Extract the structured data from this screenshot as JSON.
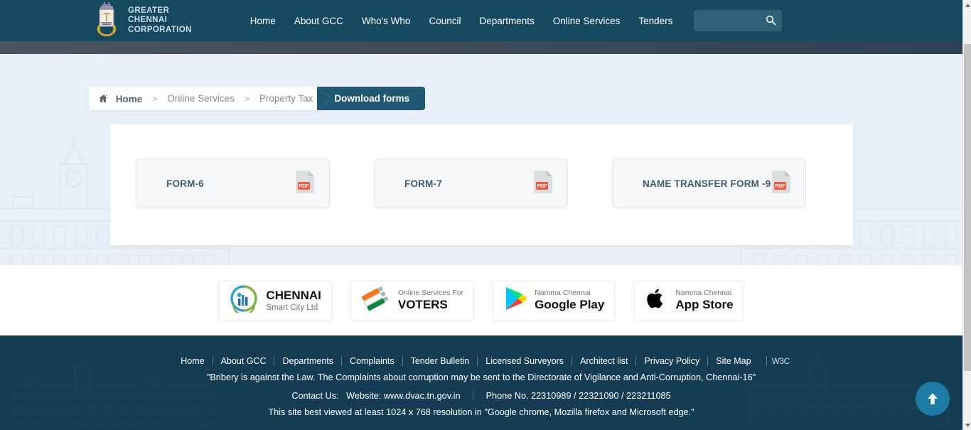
{
  "header": {
    "logo_line1": "GREATER",
    "logo_line2": "CHENNAI",
    "logo_line3": "CORPORATION",
    "nav": [
      {
        "label": "Home"
      },
      {
        "label": "About GCC"
      },
      {
        "label": "Who's Who"
      },
      {
        "label": "Council"
      },
      {
        "label": "Departments"
      },
      {
        "label": "Online Services"
      },
      {
        "label": "Tenders"
      }
    ],
    "search": {
      "value": "",
      "placeholder": ""
    }
  },
  "breadcrumb": {
    "home": "Home",
    "sep1": ">",
    "item2": "Online Services",
    "sep2": ">",
    "item3": "Property Tax",
    "active": "Download forms"
  },
  "main": {
    "cards": [
      {
        "label": "FORM-6",
        "icon": "pdf-icon"
      },
      {
        "label": "FORM-7",
        "icon": "pdf-icon"
      },
      {
        "label": "NAME TRANSFER FORM -9",
        "icon": "pdf-icon"
      }
    ]
  },
  "badges": [
    {
      "sub": "",
      "main": "CHENNAI",
      "small": "Smart City Ltd",
      "icon": "chennai-smart-city-logo"
    },
    {
      "sub": "Online Services For",
      "main": "VOTERS",
      "small": "",
      "icon": "voters-logo"
    },
    {
      "sub": "Namma Chennai",
      "main": "Google Play",
      "small": "",
      "icon": "google-play-logo"
    },
    {
      "sub": "Namma Chennai",
      "main": "App Store",
      "small": "",
      "icon": "apple-logo"
    }
  ],
  "footer": {
    "links": [
      {
        "label": "Home"
      },
      {
        "label": "About GCC"
      },
      {
        "label": "Departments"
      },
      {
        "label": "Complaints"
      },
      {
        "label": "Tender Bulletin"
      },
      {
        "label": "Licensed Surveyors"
      },
      {
        "label": "Architect list"
      },
      {
        "label": "Privacy Policy"
      },
      {
        "label": "Site Map"
      }
    ],
    "w3_badge": "W3C",
    "bribery_notice": "\"Bribery is against the Law. The Complaints about corruption may be sent to the Directorate of Vigilance and Anti-Corruption, Chennai-16\"",
    "contact_label": "Contact Us:",
    "website_label": "Website:",
    "website": "www.dvac.tn.gov.in",
    "phone": "Phone No. 22310989 / 22321090 / 223211085",
    "best_viewed": "This site best viewed at least 1024 x 768 resolution in \"Google chrome, Mozilla firefox and Microsoft edge.\""
  },
  "controls": {
    "scroll_top_button": "scroll-to-top"
  },
  "colors": {
    "header_bg": "#14495f",
    "footer_bg": "#143c52",
    "accent": "#1e5871",
    "content_bg": "#e9eff9",
    "pdf_red": "#f05a43",
    "top_button": "#1b7ba5"
  }
}
